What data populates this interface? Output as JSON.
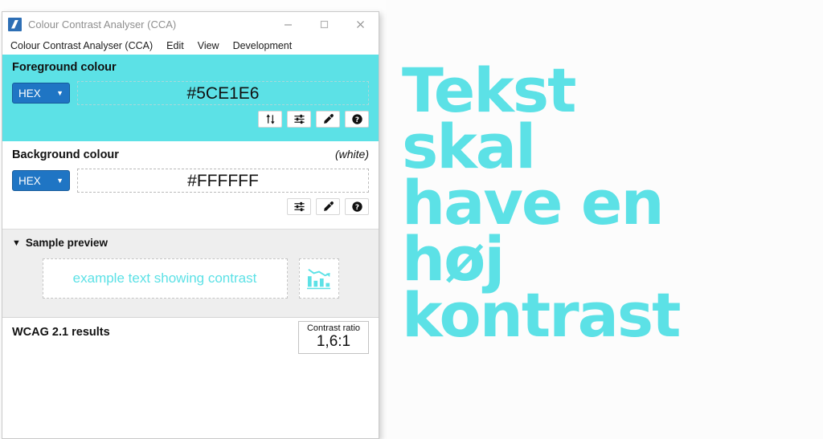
{
  "poster": {
    "text": "Tekst\nskal\nhave en\nhøj\nkontrast",
    "colour": "#5CE1E6"
  },
  "window": {
    "title": "Colour Contrast Analyser (CCA)",
    "app_icon": "cca-app-icon",
    "controls": {
      "minimize": "minimize-icon",
      "maximize": "maximize-icon",
      "close": "close-icon"
    },
    "menu": [
      {
        "label": "Colour Contrast Analyser (CCA)"
      },
      {
        "label": "Edit"
      },
      {
        "label": "View"
      },
      {
        "label": "Development"
      }
    ]
  },
  "foreground": {
    "title": "Foreground colour",
    "note": "",
    "format": "HEX",
    "value": "#5CE1E6",
    "placeholder": "#5CE1E6",
    "background_colour": "#5CE1E6",
    "buttons": [
      {
        "name": "swap-colours-button",
        "icon": "swap-vertical-icon"
      },
      {
        "name": "colour-sliders-button",
        "icon": "sliders-icon"
      },
      {
        "name": "eyedropper-button",
        "icon": "eyedropper-icon"
      },
      {
        "name": "help-button",
        "icon": "help-circle-icon"
      }
    ]
  },
  "background": {
    "title": "Background colour",
    "note": "(white)",
    "format": "HEX",
    "value": "#FFFFFF",
    "placeholder": "#FFFFFF",
    "background_colour": "#FFFFFF",
    "buttons": [
      {
        "name": "colour-sliders-button",
        "icon": "sliders-icon"
      },
      {
        "name": "eyedropper-button",
        "icon": "eyedropper-icon"
      },
      {
        "name": "help-button",
        "icon": "help-circle-icon"
      }
    ]
  },
  "sample_preview": {
    "title": "Sample preview",
    "expanded": true,
    "disclosure": "▼",
    "sample_text": "example text showing contrast",
    "sample_text_colour": "#5CE1E6",
    "chart_icon": "declining-bar-chart-icon"
  },
  "wcag": {
    "title": "WCAG 2.1 results",
    "ratio_label": "Contrast ratio",
    "ratio_value": "1,6:1"
  }
}
